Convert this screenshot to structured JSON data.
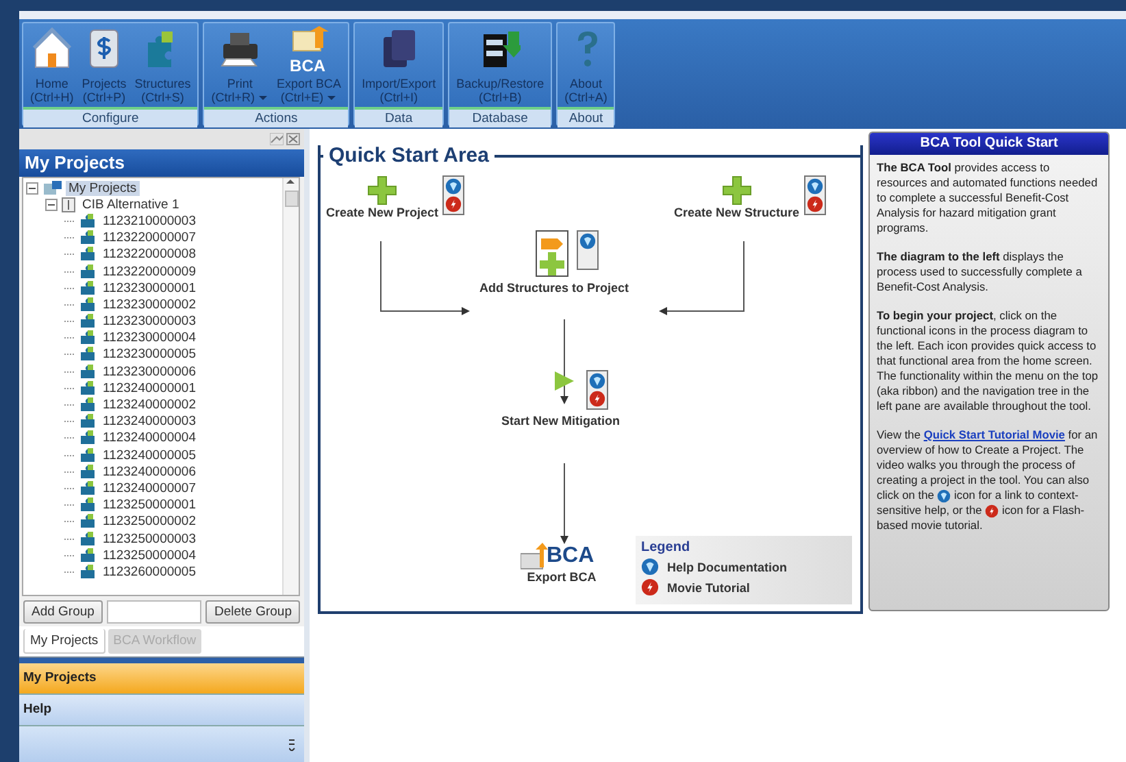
{
  "ribbon": {
    "groups": [
      {
        "label": "Configure",
        "buttons": [
          {
            "kind": "home",
            "label": "Home",
            "shortcut": "(Ctrl+H)",
            "dropdown": false
          },
          {
            "kind": "projects",
            "label": "Projects",
            "shortcut": "(Ctrl+P)",
            "dropdown": false
          },
          {
            "kind": "structures",
            "label": "Structures",
            "shortcut": "(Ctrl+S)",
            "dropdown": false
          }
        ]
      },
      {
        "label": "Actions",
        "buttons": [
          {
            "kind": "print",
            "label": "Print",
            "shortcut": "(Ctrl+R)",
            "dropdown": true
          },
          {
            "kind": "export",
            "label": "Export BCA",
            "shortcut": "(Ctrl+E)",
            "dropdown": true,
            "icon_text": "BCA"
          }
        ]
      },
      {
        "label": "Data",
        "buttons": [
          {
            "kind": "import",
            "label": "Import/Export",
            "shortcut": "(Ctrl+I)",
            "dropdown": false
          }
        ]
      },
      {
        "label": "Database",
        "buttons": [
          {
            "kind": "backup",
            "label": "Backup/Restore",
            "shortcut": "(Ctrl+B)",
            "dropdown": false
          }
        ]
      },
      {
        "label": "About",
        "buttons": [
          {
            "kind": "about",
            "label": "About",
            "shortcut": "(Ctrl+A)",
            "dropdown": false
          }
        ]
      }
    ]
  },
  "left_pane": {
    "title": "My Projects",
    "tree": [
      {
        "label": "My Projects",
        "selected": true,
        "expanded": true,
        "kind": "root",
        "children": [
          {
            "label": "CIB Alternative 1",
            "selected": false,
            "expanded": true,
            "kind": "project",
            "children": [
              {
                "label": "1123210000003",
                "selected": false,
                "kind": "structure"
              },
              {
                "label": "1123220000007",
                "selected": false,
                "kind": "structure"
              },
              {
                "label": "1123220000008",
                "selected": false,
                "kind": "structure"
              },
              {
                "label": "1123220000009",
                "selected": false,
                "kind": "structure"
              },
              {
                "label": "1123230000001",
                "selected": false,
                "kind": "structure"
              },
              {
                "label": "1123230000002",
                "selected": false,
                "kind": "structure"
              },
              {
                "label": "1123230000003",
                "selected": false,
                "kind": "structure"
              },
              {
                "label": "1123230000004",
                "selected": false,
                "kind": "structure"
              },
              {
                "label": "1123230000005",
                "selected": false,
                "kind": "structure"
              },
              {
                "label": "1123230000006",
                "selected": false,
                "kind": "structure"
              },
              {
                "label": "1123240000001",
                "selected": false,
                "kind": "structure"
              },
              {
                "label": "1123240000002",
                "selected": false,
                "kind": "structure"
              },
              {
                "label": "1123240000003",
                "selected": false,
                "kind": "structure"
              },
              {
                "label": "1123240000004",
                "selected": false,
                "kind": "structure"
              },
              {
                "label": "1123240000005",
                "selected": false,
                "kind": "structure"
              },
              {
                "label": "1123240000006",
                "selected": false,
                "kind": "structure"
              },
              {
                "label": "1123240000007",
                "selected": false,
                "kind": "structure"
              },
              {
                "label": "1123250000001",
                "selected": false,
                "kind": "structure"
              },
              {
                "label": "1123250000002",
                "selected": false,
                "kind": "structure"
              },
              {
                "label": "1123250000003",
                "selected": false,
                "kind": "structure"
              },
              {
                "label": "1123250000004",
                "selected": false,
                "kind": "structure"
              },
              {
                "label": "1123260000005",
                "selected": false,
                "kind": "structure"
              }
            ]
          }
        ]
      }
    ],
    "add_button": "Add Group",
    "delete_button": "Delete Group",
    "tabs": [
      {
        "label": "My Projects",
        "selected": true,
        "disabled": false
      },
      {
        "label": "BCA Workflow",
        "selected": false,
        "disabled": true
      }
    ],
    "nav": [
      {
        "label": "My Projects",
        "selected": true
      },
      {
        "label": "Help",
        "selected": false
      }
    ]
  },
  "quick_start": {
    "title": "Quick Start Area",
    "nodes": [
      {
        "kind": "create-project",
        "label": "Create New Project",
        "help": true,
        "movie": true
      },
      {
        "kind": "create-structure",
        "label": "Create New Structure",
        "help": true,
        "movie": true
      },
      {
        "kind": "add-structures",
        "label": "Add Structures to Project",
        "help": true,
        "movie": false
      },
      {
        "kind": "mitigation",
        "label": "Start New Mitigation",
        "help": true,
        "movie": true
      },
      {
        "kind": "export",
        "label": "Export BCA",
        "icon_text": "BCA"
      }
    ],
    "legend": {
      "title": "Legend",
      "items": [
        {
          "kind": "help",
          "label": "Help Documentation"
        },
        {
          "kind": "movie",
          "label": "Movie Tutorial"
        }
      ]
    }
  },
  "help_panel": {
    "title": "BCA Tool Quick Start",
    "paragraphs": [
      [
        {
          "kind": "text",
          "text": "**The BCA Tool** provides access to resources and automated functions needed to complete a successful Benefit-Cost Analysis for hazard mitigation grant programs."
        }
      ],
      [
        {
          "kind": "text",
          "text": "**The diagram to the left** displays the process used to successfully complete a Benefit-Cost Analysis."
        }
      ],
      [
        {
          "kind": "text",
          "text": "**To begin your project**, click on the functional icons in the process diagram to the left.  Each icon provides quick access to that functional area from the home screen. The functionality within the menu on the top (aka ribbon) and the navigation tree in the left pane are available throughout the tool."
        }
      ],
      [
        {
          "kind": "text",
          "text": "View the "
        },
        {
          "kind": "link",
          "text": "Quick Start Tutorial Movie"
        },
        {
          "kind": "text",
          "text": " for an overview of how to Create a Project. The video walks you through the process of creating a project in the tool. You can also click on the "
        },
        {
          "kind": "help-icon"
        },
        {
          "kind": "text",
          "text": " icon for a link to context-sensitive help, or the "
        },
        {
          "kind": "movie-icon"
        },
        {
          "kind": "text",
          "text": " icon for a Flash-based movie tutorial."
        }
      ]
    ]
  }
}
